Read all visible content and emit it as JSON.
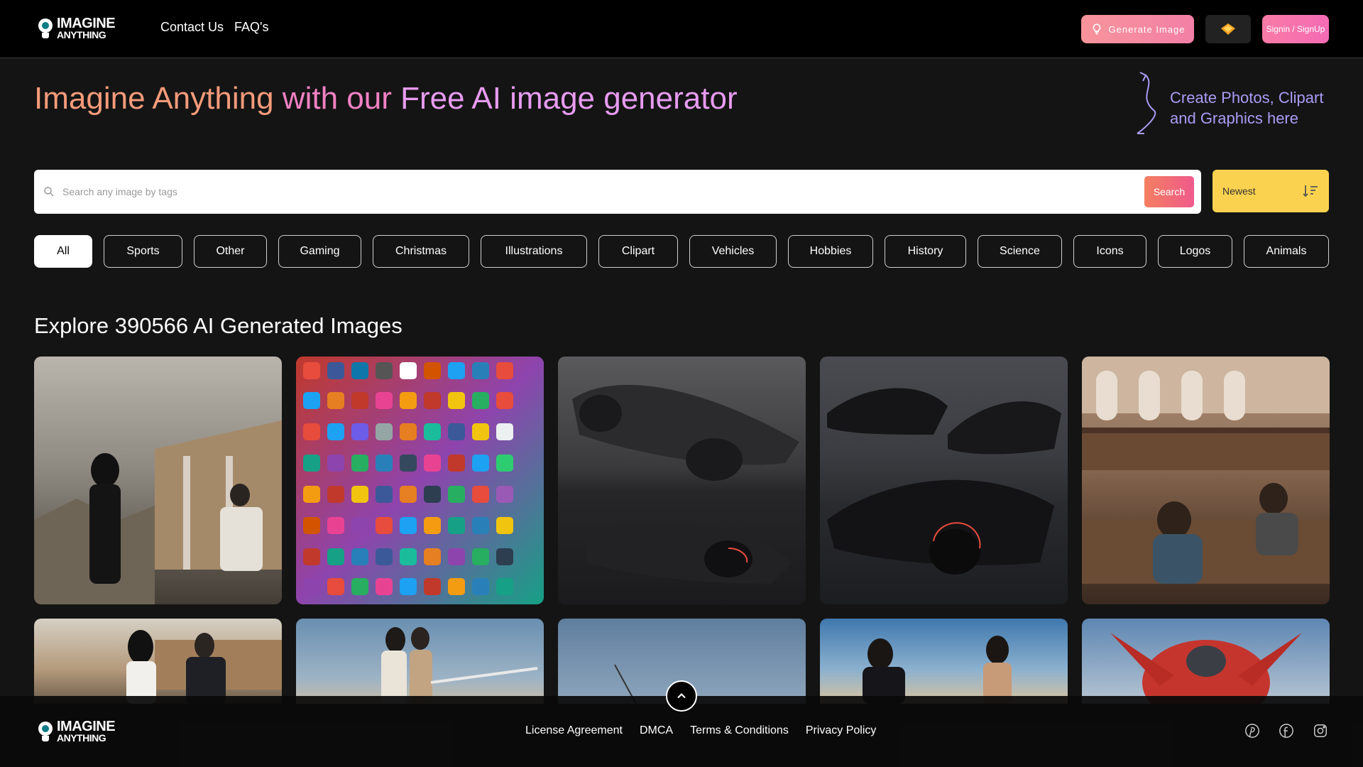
{
  "header": {
    "logo_line1": "IMAGINE",
    "logo_line2": "ANYTHING",
    "nav": [
      "Contact Us",
      "FAQ's"
    ],
    "generate_label": "Generate Image",
    "signin_label": "Signin / SignUp"
  },
  "hero": {
    "title_part1": "Imagine Anything",
    "title_part2": "with our",
    "title_part3": "Free AI image generator",
    "note": "Create Photos, Clipart and Graphics here"
  },
  "search": {
    "placeholder": "Search any image by tags",
    "button_label": "Search",
    "sort_value": "Newest"
  },
  "categories": [
    "All",
    "Sports",
    "Other",
    "Gaming",
    "Christmas",
    "Illustrations",
    "Clipart",
    "Vehicles",
    "Hobbies",
    "History",
    "Science",
    "Icons",
    "Logos",
    "Animals"
  ],
  "explore_title": "Explore 390566 AI Generated Images",
  "footer": {
    "logo_line1": "IMAGINE",
    "logo_line2": "ANYTHING",
    "links": [
      "License Agreement",
      "DMCA",
      "Terms & Conditions",
      "Privacy Policy"
    ],
    "social_icons": [
      "pinterest-icon",
      "facebook-icon",
      "instagram-icon"
    ]
  },
  "colors": {
    "accent_orange": "#f59b7a",
    "accent_pink": "#f281c4",
    "sort_yellow": "#fbd24f",
    "note_purple": "#a99cf5"
  }
}
